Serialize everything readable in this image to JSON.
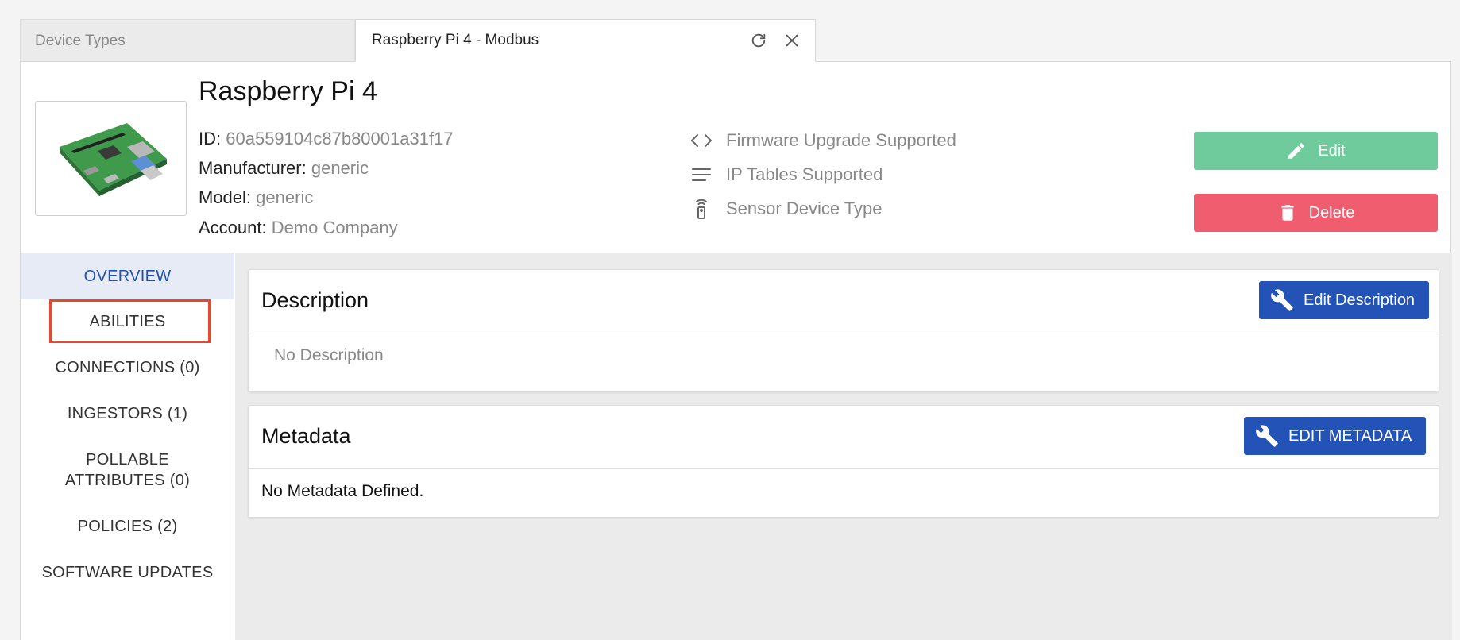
{
  "tabs": {
    "inactive_label": "Device Types",
    "active_label": "Raspberry Pi 4 - Modbus"
  },
  "device": {
    "title": "Raspberry Pi 4",
    "id_label": "ID:",
    "id_value": "60a559104c87b80001a31f17",
    "manufacturer_label": "Manufacturer:",
    "manufacturer_value": "generic",
    "model_label": "Model:",
    "model_value": "generic",
    "account_label": "Account:",
    "account_value": "Demo Company"
  },
  "features": [
    {
      "label": "Firmware Upgrade Supported",
      "icon": "code-icon"
    },
    {
      "label": "IP Tables Supported",
      "icon": "lines-icon"
    },
    {
      "label": "Sensor Device Type",
      "icon": "remote-sensor-icon"
    }
  ],
  "actions": {
    "edit_label": "Edit",
    "delete_label": "Delete"
  },
  "sidebar": {
    "items": [
      {
        "label": "OVERVIEW"
      },
      {
        "label": "ABILITIES"
      },
      {
        "label": "CONNECTIONS (0)"
      },
      {
        "label": "INGESTORS (1)"
      },
      {
        "label": "POLLABLE ATTRIBUTES (0)"
      },
      {
        "label": "POLICIES (2)"
      },
      {
        "label": "SOFTWARE UPDATES"
      }
    ]
  },
  "description_card": {
    "title": "Description",
    "button_label": "Edit Description",
    "body": "No Description"
  },
  "metadata_card": {
    "title": "Metadata",
    "button_label": "EDIT METADATA",
    "body": "No Metadata Defined."
  },
  "colors": {
    "edit_button": "#70cb9c",
    "delete_button": "#ef5d6f",
    "primary_button": "#2453b7",
    "active_nav_text": "#2350b0",
    "highlight_box": "#e54a2f"
  }
}
